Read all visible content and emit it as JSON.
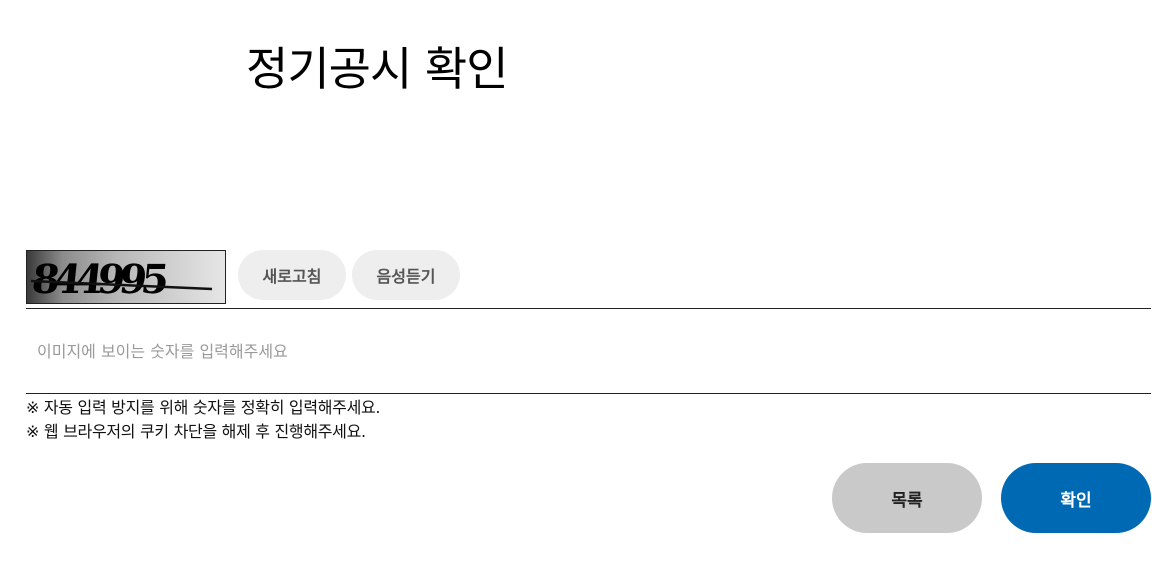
{
  "page": {
    "title": "정기공시 확인"
  },
  "captcha": {
    "image_text": "844995",
    "refresh_label": "새로고침",
    "audio_label": "음성듣기",
    "input_placeholder": "이미지에 보이는 숫자를 입력해주세요",
    "input_value": ""
  },
  "notices": [
    "※ 자동 입력 방지를 위해 숫자를 정확히 입력해주세요.",
    "※ 웹 브라우저의 쿠키 차단을 해제 후 진행해주세요."
  ],
  "actions": {
    "list_label": "목록",
    "confirm_label": "확인"
  },
  "colors": {
    "confirm_button_bg": "#0069b4",
    "list_button_bg": "#c9c9c9",
    "pill_button_bg": "#eeeeee"
  }
}
